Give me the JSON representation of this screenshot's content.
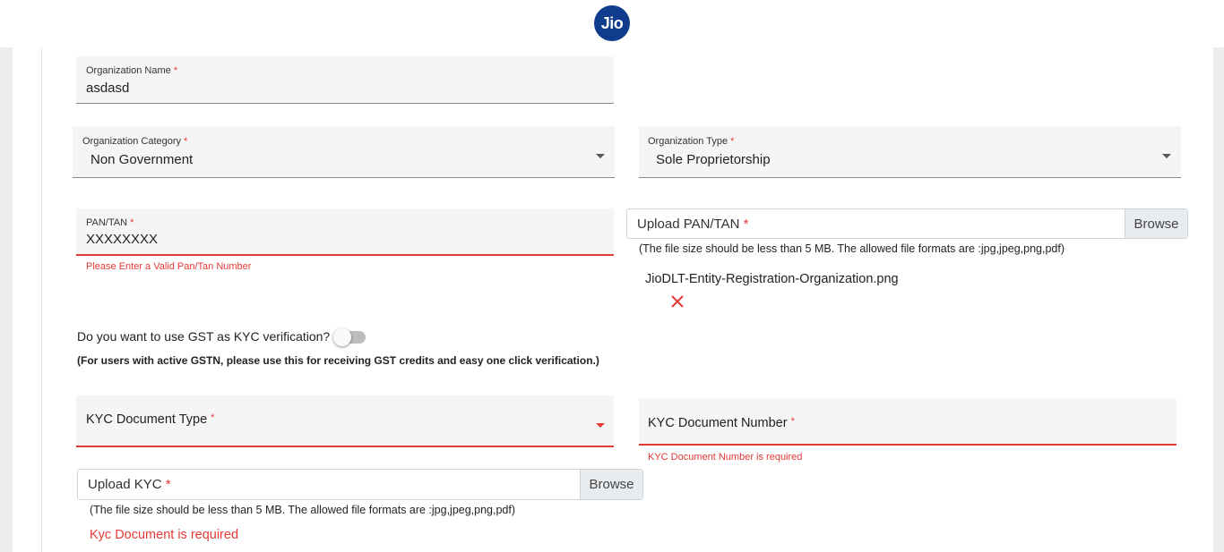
{
  "header": {
    "logo_text": "Jio"
  },
  "form": {
    "org_name": {
      "label": "Organization Name",
      "required": "*",
      "value": "asdasd"
    },
    "org_category": {
      "label": "Organization Category",
      "required": "*",
      "value": "Non Government"
    },
    "org_type": {
      "label": "Organization Type",
      "required": "*",
      "value": "Sole Proprietorship"
    },
    "pan": {
      "label": "PAN/TAN",
      "required": "*",
      "value": "XXXXXXXX",
      "error": "Please Enter a Valid Pan/Tan Number"
    },
    "pan_upload": {
      "label": "Upload PAN/TAN",
      "required": "*",
      "browse": "Browse",
      "hint": "(The file size should be less than 5 MB. The allowed file formats are :jpg,jpeg,png,pdf)",
      "file_name": "JioDLT-Entity-Registration-Organization.png"
    },
    "gst": {
      "question": "Do you want to use GST as KYC verification?",
      "enabled": false,
      "note": "(For users with active GSTN, please use this for receiving GST credits and easy one click verification.)"
    },
    "kyc_type": {
      "label": "KYC Document Type",
      "required": "*",
      "value": ""
    },
    "kyc_number": {
      "label": "KYC Document Number",
      "required": "*",
      "value": "",
      "error": "KYC Document Number is required"
    },
    "kyc_upload": {
      "label": "Upload KYC",
      "required": "*",
      "browse": "Browse",
      "hint": "(The file size should be less than 5 MB. The allowed file formats are :jpg,jpeg,png,pdf)",
      "error": "Kyc Document is required"
    }
  },
  "colors": {
    "error": "#e53935",
    "logo_bg": "#0f3c8c",
    "field_bg": "#f5f5f5"
  }
}
